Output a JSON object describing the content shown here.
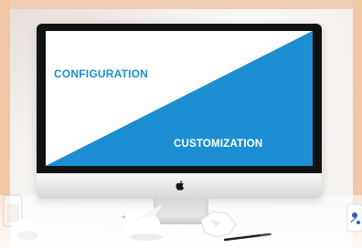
{
  "screen": {
    "top_left_text": "CONFIGURATION",
    "bottom_right_text": "CUSTOMIZATION"
  },
  "colors": {
    "screen_white": "#ffffff",
    "screen_blue": "#1c8fd3",
    "text_blue": "#1c8fd3",
    "text_white": "#ffffff"
  },
  "icons": {
    "apple_logo": "apple-logo-icon"
  }
}
